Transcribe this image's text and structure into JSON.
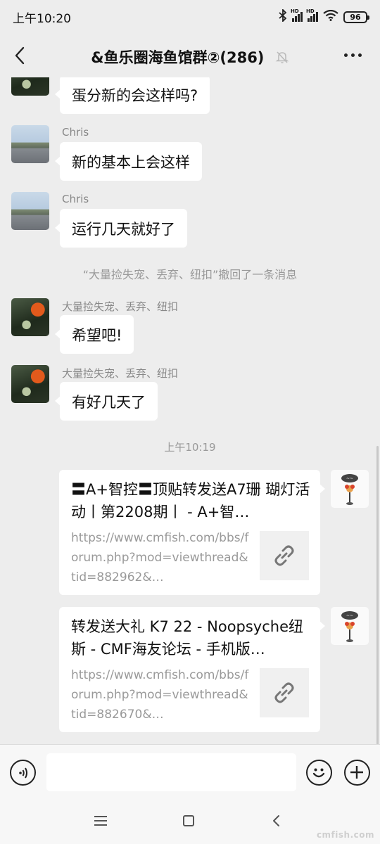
{
  "status_bar": {
    "time": "上午10:20",
    "bluetooth_icon": "bluetooth-icon",
    "signal_1_label": "HD",
    "signal_2_label": "HD",
    "wifi_icon": "wifi-icon",
    "battery_level": "96"
  },
  "header": {
    "title": "&鱼乐圈海鱼馆群②(286)",
    "back_icon": "chevron-left-icon",
    "mute_icon": "bell-off-icon",
    "more_icon": "more-horizontal-icon"
  },
  "messages": [
    {
      "sender": "",
      "text": "蛋分新的会这样吗?"
    },
    {
      "sender": "Chris",
      "text": "新的基本上会这样"
    },
    {
      "sender": "Chris",
      "text": "运行几天就好了"
    },
    {
      "system": "“大量捡失宠、丢弃、纽扣”撤回了一条消息"
    },
    {
      "sender": "大量捡失宠、丢弃、纽扣",
      "text": "希望吧!"
    },
    {
      "sender": "大量捡失宠、丢弃、纽扣",
      "text": "有好几天了"
    }
  ],
  "time_divider": "上午10:19",
  "link_cards": [
    {
      "title": "〓A+智控〓顶贴转发送A7珊 瑚灯活动丨第2208期丨 - A+智…",
      "url": "https://www.cmfish.com/bbs/forum.php?mod=viewthread&tid=882962&…",
      "thumb_icon": "link-icon"
    },
    {
      "title": "转发送大礼 K7 22 - Noopsyche纽斯 - CMF海友论坛 - 手机版…",
      "url": "https://www.cmfish.com/bbs/forum.php?mod=viewthread&tid=882670&…",
      "thumb_icon": "link-icon"
    }
  ],
  "input_bar": {
    "voice_icon": "voice-icon",
    "input_value": "",
    "emoji_icon": "emoji-icon",
    "plus_icon": "plus-icon"
  },
  "nav_bar": {
    "menu_icon": "menu-icon",
    "home_icon": "home-icon",
    "back_icon": "back-icon"
  },
  "watermark": "cmfish.com"
}
